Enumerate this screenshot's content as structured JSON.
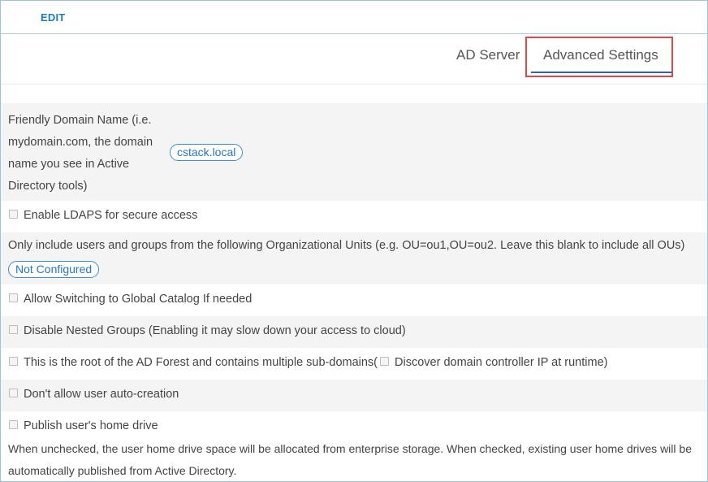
{
  "header": {
    "edit_label": "EDIT"
  },
  "tabs": [
    {
      "label": "AD Server",
      "active": false
    },
    {
      "label": "Advanced Settings",
      "active": true
    }
  ],
  "colors": {
    "accent": "#1f7bc1",
    "highlight": "#e04848",
    "tab_underline": "#2a66b5"
  },
  "settings": {
    "friendly_domain_label": "Friendly Domain Name (i.e. mydomain.com, the domain name you see in Active Directory tools)",
    "friendly_domain_value": "cstack.local",
    "ldaps_label": "Enable LDAPS for secure access",
    "ou_label": "Only include users and groups from the following Organizational Units (e.g. OU=ou1,OU=ou2. Leave this blank to include all OUs)",
    "ou_value": "Not Configured",
    "global_catalog_label": "Allow Switching to Global Catalog If needed",
    "nested_groups_label": "Disable Nested Groups (Enabling it may slow down your access to cloud)",
    "root_forest_label": "This is the root of the AD Forest and contains multiple sub-domains(",
    "discover_dc_label": "Discover domain controller IP at runtime)",
    "auto_creation_label": "Don't allow user auto-creation",
    "home_drive_label": "Publish user's home drive",
    "home_drive_note": "When unchecked, the user home drive space will be allocated from enterprise storage. When checked, existing user home drives will be automatically published from Active Directory."
  }
}
